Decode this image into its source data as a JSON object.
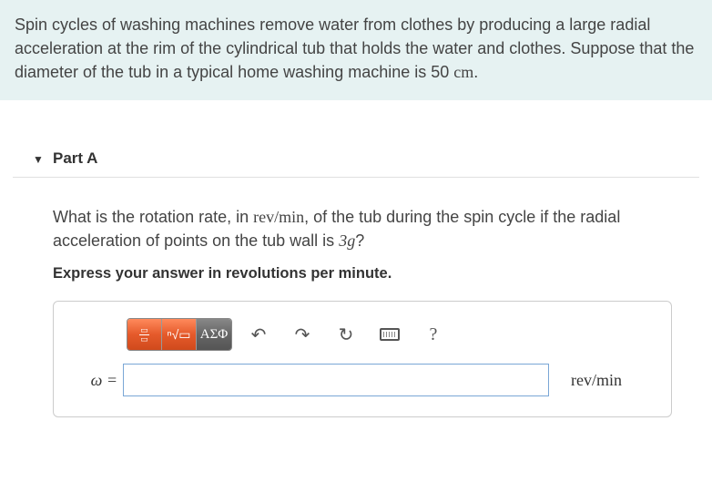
{
  "problem": {
    "text_pre": "Spin cycles of washing machines remove water from clothes by producing a large radial acceleration at the rim of the cylindrical tub that holds the water and clothes. Suppose that the diameter of the tub in a typical home washing machine is 50 ",
    "diameter_unit": "cm",
    "text_post": "."
  },
  "part": {
    "label": "Part A",
    "question_pre": "What is the rotation rate, in ",
    "question_unit": "rev/min",
    "question_mid": ", of the tub during the spin cycle if the radial acceleration of points on the tub wall is ",
    "accel_value": "3g",
    "question_post": "?",
    "instruction": "Express your answer in revolutions per minute."
  },
  "toolbar": {
    "fraction_label": "fraction",
    "root_label": "√",
    "greek_label": "ΑΣΦ",
    "undo": "↶",
    "redo": "↷",
    "reset": "↻",
    "keyboard": "keyboard",
    "help": "?"
  },
  "answer": {
    "var_label": "ω =",
    "value": "",
    "unit": "rev/min"
  }
}
